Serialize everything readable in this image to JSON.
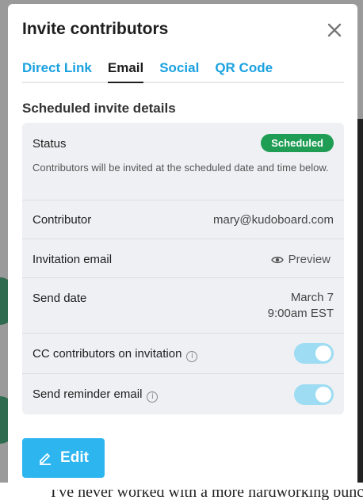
{
  "modal": {
    "title": "Invite contributors",
    "close_icon": "close-icon"
  },
  "tabs": [
    {
      "label": "Direct Link",
      "active": false
    },
    {
      "label": "Email",
      "active": true
    },
    {
      "label": "Social",
      "active": false
    },
    {
      "label": "QR Code",
      "active": false
    }
  ],
  "section_title": "Scheduled invite details",
  "details": {
    "status": {
      "label": "Status",
      "badge": "Scheduled",
      "badge_color": "#1f9d55",
      "description": "Contributors will be invited at the scheduled date and time below."
    },
    "contributor": {
      "label": "Contributor",
      "value": "mary@kudoboard.com"
    },
    "invitation_email": {
      "label": "Invitation email",
      "preview_label": "Preview",
      "preview_icon": "eye-icon"
    },
    "send_date": {
      "label": "Send date",
      "date": "March 7",
      "time": "9:00am EST"
    },
    "cc_contributors": {
      "label": "CC contributors on invitation",
      "info_icon": "info-icon",
      "enabled": true
    },
    "send_reminder": {
      "label": "Send reminder email",
      "info_icon": "info-icon",
      "enabled": true
    }
  },
  "edit_button": {
    "label": "Edit",
    "icon": "pencil-icon",
    "color": "#2db5f0"
  },
  "backdrop_text": "I've never worked with a more hardworking bunch"
}
